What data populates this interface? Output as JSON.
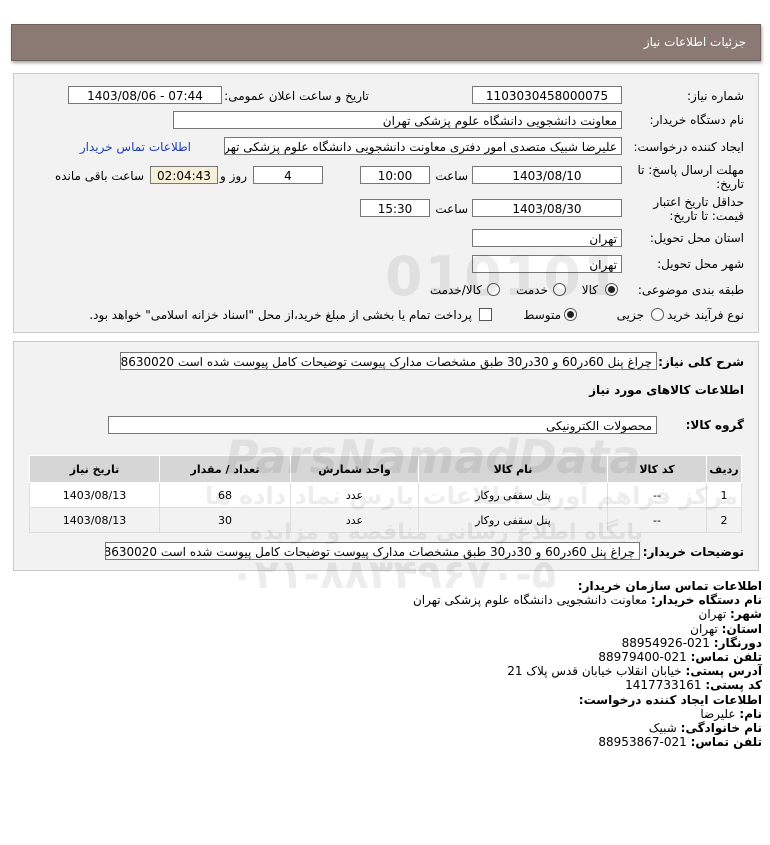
{
  "header": {
    "title": "جزئیات اطلاعات نیاز"
  },
  "form": {
    "need_number_label": "شماره نیاز:",
    "need_number": "1103030458000075",
    "announce_label": "تاریخ و ساعت اعلان عمومی:",
    "announce_value": "1403/08/06 - 07:44",
    "buyer_org_label": "نام دستگاه خریدار:",
    "buyer_org": "معاونت دانشجویی دانشگاه علوم پزشکی تهران",
    "creator_label": "ایجاد کننده درخواست:",
    "creator": "علیرضا شبیک متصدی امور دفتری معاونت دانشجویی دانشگاه علوم پزشکی تهر",
    "contact_link": "اطلاعات تماس خریدار",
    "deadline_label_1": "مهلت ارسال پاسخ: تا",
    "deadline_label_2": "تاریخ:",
    "deadline_date": "1403/08/10",
    "time_label": "ساعت",
    "deadline_time": "10:00",
    "days_value": "4",
    "days_label": "روز و",
    "remaining_value": "02:04:43",
    "remaining_label": "ساعت باقی مانده",
    "validity_label_1": "حداقل تاریخ اعتبار",
    "validity_label_2": "قیمت: تا تاریخ:",
    "validity_date": "1403/08/30",
    "validity_time": "15:30",
    "province_label": "استان محل تحویل:",
    "province": "تهران",
    "city_label": "شهر محل تحویل:",
    "city": "تهران",
    "category_label": "طبقه بندی موضوعی:",
    "category_options": [
      "کالا",
      "خدمت",
      "کالا/خدمت"
    ],
    "category_selected": "کالا",
    "process_label": "نوع فرآیند خرید :",
    "process_options": [
      "جزیی",
      "متوسط"
    ],
    "process_selected": "متوسط",
    "payment_note": "پرداخت تمام یا بخشی از مبلغ خرید،از محل \"اسناد خزانه اسلامی\" خواهد بود."
  },
  "details": {
    "summary_label": "شرح کلی نیاز:",
    "summary": "چراغ پنل 60در60 و 30در30 طبق مشخصات مدارک پیوست توضیحات کامل پیوست شده است 88630020",
    "goods_info_title": "اطلاعات کالاهای مورد نیاز",
    "group_label": "گروه کالا:",
    "group_value": "محصولات الکترونیکی",
    "table": {
      "headers": [
        "ردیف",
        "کد کالا",
        "نام کالا",
        "واحد شمارش",
        "تعداد / مقدار",
        "تاریخ نیاز"
      ],
      "rows": [
        [
          "1",
          "--",
          "پنل سقفی روکار",
          "عدد",
          "68",
          "1403/08/13"
        ],
        [
          "2",
          "--",
          "پنل سقفی روکار",
          "عدد",
          "30",
          "1403/08/13"
        ]
      ]
    },
    "buyer_notes_label": "توضیحات خریدار:",
    "buyer_notes": "چراغ پنل 60در60 و 30در30 طبق مشخصات مدارک پیوست توضیحات کامل پیوست شده است 88630020"
  },
  "contact": {
    "org_title": "اطلاعات تماس سازمان خریدار:",
    "buyer_name_label": "نام دستگاه خریدار:",
    "buyer_name": "معاونت دانشجویی دانشگاه علوم پزشکی تهران",
    "city_label": "شهر:",
    "city": "تهران",
    "province_label": "استان:",
    "province": "تهران",
    "fax_label": "دورنگار:",
    "fax": "021-88954926",
    "phone_label": "تلفن تماس:",
    "phone": "021-88979400",
    "address_label": "آدرس پستی:",
    "address": "خیابان انقلاب خیابان قدس پلاک 21",
    "postal_label": "کد پستی:",
    "postal": "1417733161",
    "creator_title": "اطلاعات ایجاد کننده درخواست:",
    "first_name_label": "نام:",
    "first_name": "علیرضا",
    "last_name_label": "نام خانوادگی:",
    "last_name": "شبیک",
    "creator_phone_label": "تلفن تماس:",
    "creator_phone": "021-88953867"
  },
  "watermark": {
    "brand": "ParsNamadData",
    "tagline": "مرکز فراهم آوری اطلاعات پارس نماد داده ها",
    "tagline2": "پایگاه اطلاع رسانی مناقصه و مزایده",
    "phone": "۰۲۱-۸۸۳۴۹۶۷۰-۵",
    "digits": "010101"
  }
}
